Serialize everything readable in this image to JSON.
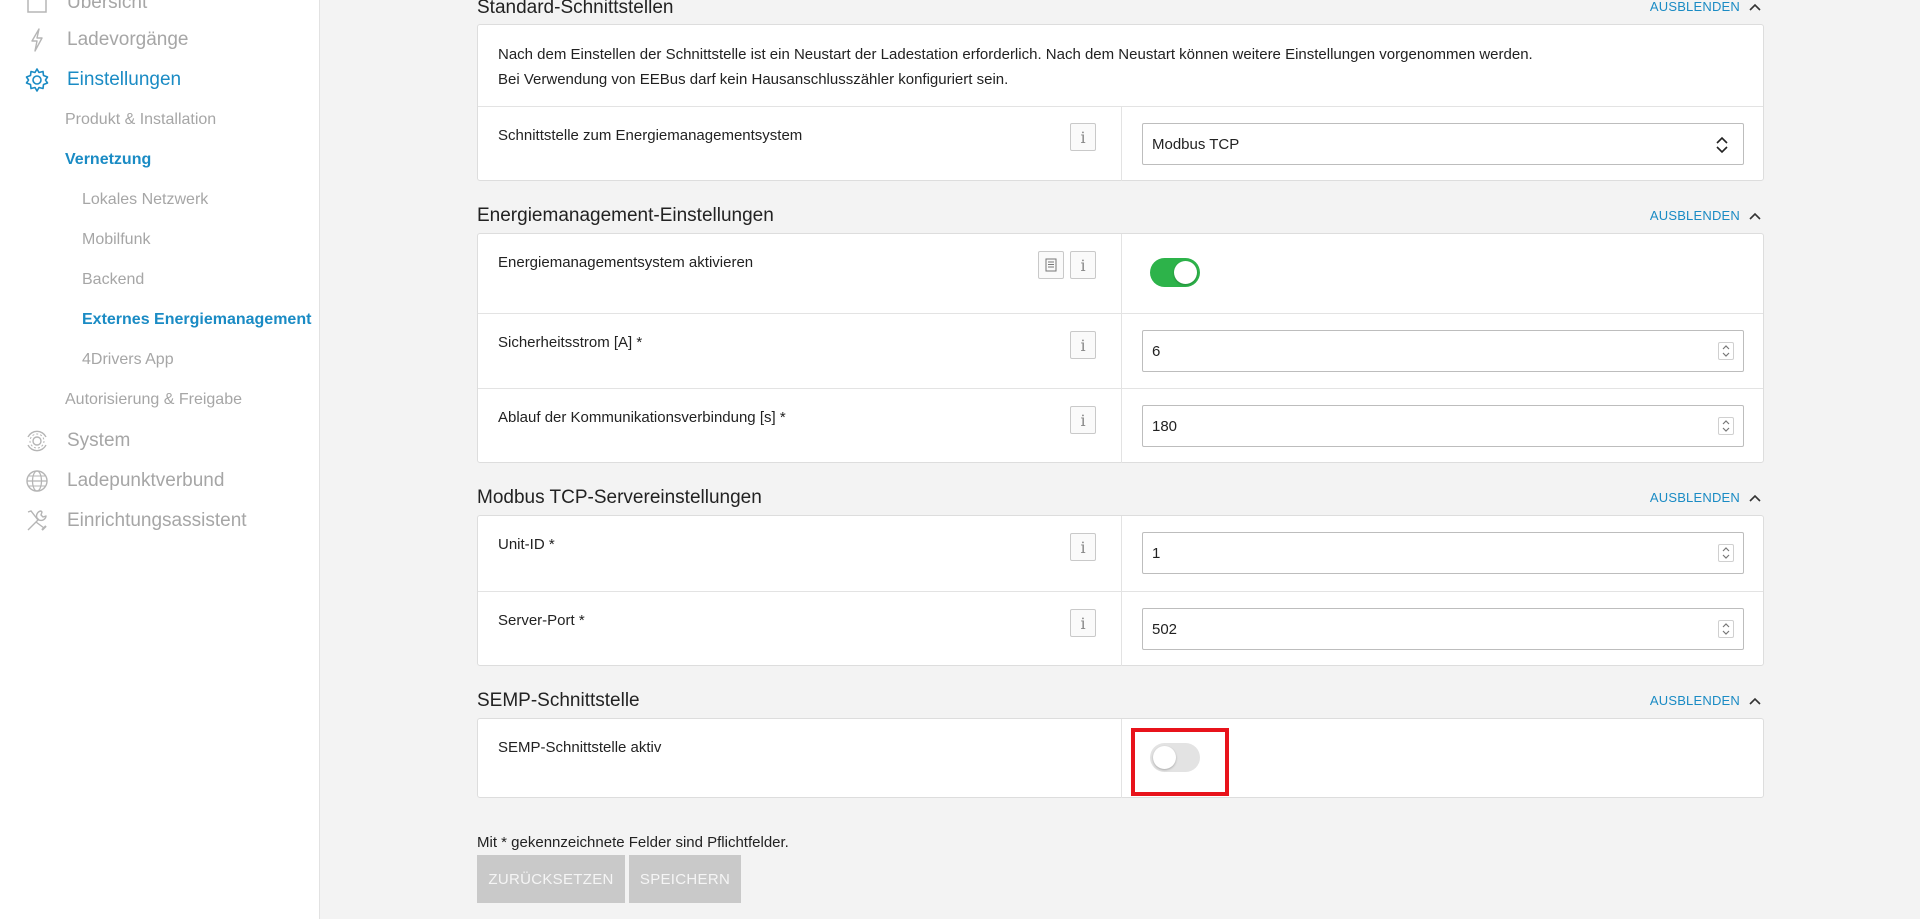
{
  "sidebar": {
    "overview": "Übersicht",
    "charging": "Ladevorgänge",
    "settings": "Einstellungen",
    "product_installation": "Produkt & Installation",
    "networking": "Vernetzung",
    "local_network": "Lokales Netzwerk",
    "mobile": "Mobilfunk",
    "backend": "Backend",
    "external_energy": "Externes Energiemanagement",
    "drivers_app": "4Drivers App",
    "authorization": "Autorisierung & Freigabe",
    "system": "System",
    "charge_point_group": "Ladepunktverbund",
    "setup_assistant": "Einrichtungsassistent"
  },
  "hide_label": "AUSBLENDEN",
  "info_glyph": "i",
  "standard_interfaces": {
    "title": "Standard-Schnittstellen",
    "info_line1": "Nach dem Einstellen der Schnittstelle ist ein Neustart der Ladestation erforderlich. Nach dem Neustart können weitere Einstellungen vorgenommen werden.",
    "info_line2": "Bei Verwendung von EEBus darf kein Hausanschlusszähler konfiguriert sein.",
    "interface_label": "Schnittstelle zum Energiemanagementsystem",
    "interface_value": "Modbus TCP"
  },
  "energy_settings": {
    "title": "Energiemanagement-Einstellungen",
    "activate_label": "Energiemanagementsystem aktivieren",
    "activate_on": true,
    "safety_current_label": "Sicherheitsstrom [A] *",
    "safety_current_value": "6",
    "timeout_label": "Ablauf der Kommunikationsverbindung [s] *",
    "timeout_value": "180"
  },
  "modbus_server": {
    "title": "Modbus TCP-Servereinstellungen",
    "unit_id_label": "Unit-ID *",
    "unit_id_value": "1",
    "port_label": "Server-Port *",
    "port_value": "502"
  },
  "semp": {
    "title": "SEMP-Schnittstelle",
    "active_label": "SEMP-Schnittstelle aktiv",
    "active_on": false
  },
  "footer": {
    "required_note": "Mit * gekennzeichnete Felder sind Pflichtfelder.",
    "reset_label": "ZURÜCKSETZEN",
    "save_label": "SPEICHERN"
  },
  "colors": {
    "accent": "#1a8bc4",
    "toggle_on": "#2db34a",
    "highlight": "#e8131b"
  }
}
